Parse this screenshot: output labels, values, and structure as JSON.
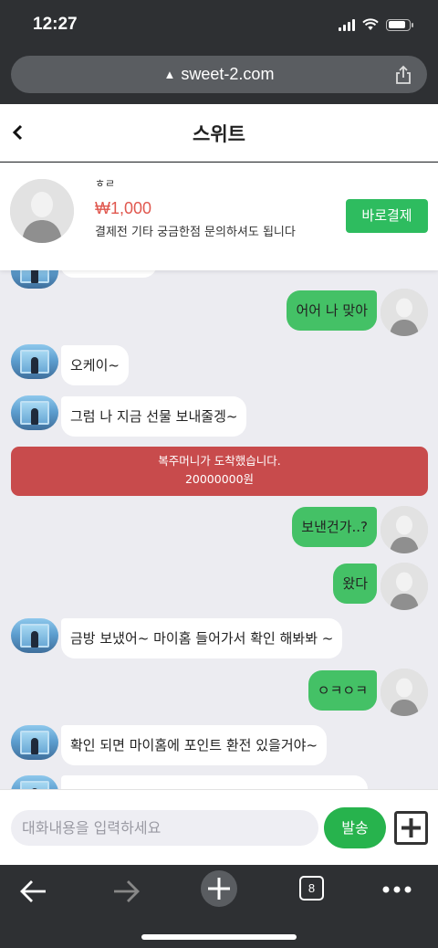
{
  "status_bar": {
    "time": "12:27",
    "battery_level": 0.85
  },
  "browser": {
    "url": "sweet-2.com",
    "tab_count": "8"
  },
  "header": {
    "title": "스위트"
  },
  "product": {
    "name": "ㅎㄹ",
    "price": "₩1,000",
    "description": "결제전 기타 궁금한점 문의하셔도 됩니다",
    "pay_button": "바로결제"
  },
  "messages": [
    {
      "side": "right",
      "text": "어어 나 맞아"
    },
    {
      "side": "left",
      "text": "오케이~"
    },
    {
      "side": "left",
      "text": "그럼 나 지금 선물 보내줄겡~"
    },
    {
      "side": "notice",
      "text": "복주머니가 도착했습니다.",
      "amount": "20000000원"
    },
    {
      "side": "right",
      "text": "보낸건가..?"
    },
    {
      "side": "right",
      "text": "왔다"
    },
    {
      "side": "left",
      "text": "금방 보냈어~ 마이홈 들어가서 확인 해봐봐 ~"
    },
    {
      "side": "right",
      "text": "ㅇㅋㅇㅋ"
    },
    {
      "side": "left",
      "text": "확인 되면 마이홈에 포인트 환전 있을거야~"
    }
  ],
  "input": {
    "placeholder": "대화내용을 입력하세요",
    "send_label": "발송"
  },
  "colors": {
    "accent_green": "#44c166",
    "notice_red": "#c84b4c",
    "price_red": "#e0584f"
  }
}
